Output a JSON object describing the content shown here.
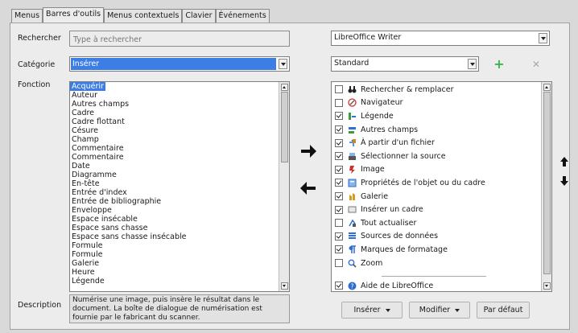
{
  "tabs": [
    "Menus",
    "Barres d'outils",
    "Menus contextuels",
    "Clavier",
    "Événements"
  ],
  "colors": {
    "selection": "#3d7ee6",
    "add_icon": "#39b54a"
  },
  "search": {
    "label": "Rechercher",
    "placeholder": "Type à rechercher",
    "value": ""
  },
  "category": {
    "label": "Catégorie",
    "value": "Insérer"
  },
  "function": {
    "label": "Fonction",
    "items": [
      "Acquérir",
      "Auteur",
      "Autres champs",
      "Cadre",
      "Cadre flottant",
      "Césure",
      "Champ",
      "Commentaire",
      "Commentaire",
      "Date",
      "Diagramme",
      "En-tête",
      "Entrée d'index",
      "Entrée de bibliographie",
      "Enveloppe",
      "Espace insécable",
      "Espace sans chasse",
      "Espace sans chasse insécable",
      "Formule",
      "Formule",
      "Galerie",
      "Heure",
      "Légende"
    ]
  },
  "description": {
    "label": "Description",
    "text": "Numérise une image, puis insère le résultat dans le document. La boîte de dialogue de numérisation est fournie par le fabricant du scanner."
  },
  "scope": {
    "value": "LibreOffice Writer"
  },
  "toolbar": {
    "value": "Standard",
    "add_icon": "plus-icon",
    "remove_icon": "close-icon"
  },
  "commands": [
    {
      "checked": false,
      "icon": "binoculars-icon",
      "label": "Rechercher & remplacer"
    },
    {
      "checked": false,
      "icon": "navigator-icon",
      "label": "Navigateur"
    },
    {
      "checked": true,
      "icon": "caption-icon",
      "label": "Légende"
    },
    {
      "checked": true,
      "icon": "fields-icon",
      "label": "Autres champs"
    },
    {
      "checked": true,
      "icon": "insert-file-icon",
      "label": "À partir d'un fichier"
    },
    {
      "checked": true,
      "icon": "scanner-icon",
      "label": "Sélectionner la source"
    },
    {
      "checked": true,
      "icon": "image-icon",
      "label": "Image"
    },
    {
      "checked": true,
      "icon": "properties-icon",
      "label": "Propriétés de l'objet ou du cadre"
    },
    {
      "checked": true,
      "icon": "gallery-icon",
      "label": "Galerie"
    },
    {
      "checked": true,
      "icon": "frame-icon",
      "label": "Insérer un cadre"
    },
    {
      "checked": false,
      "icon": "update-icon",
      "label": "Tout actualiser"
    },
    {
      "checked": true,
      "icon": "datasource-icon",
      "label": "Sources de données"
    },
    {
      "checked": true,
      "icon": "formatting-marks-icon",
      "label": "Marques de formatage"
    },
    {
      "checked": false,
      "icon": "zoom-icon",
      "label": "Zoom"
    }
  ],
  "help_command": {
    "checked": true,
    "icon": "help-icon",
    "label": "Aide de LibreOffice"
  },
  "buttons": {
    "insert": "Insérer",
    "modify": "Modifier",
    "default": "Par défaut"
  }
}
